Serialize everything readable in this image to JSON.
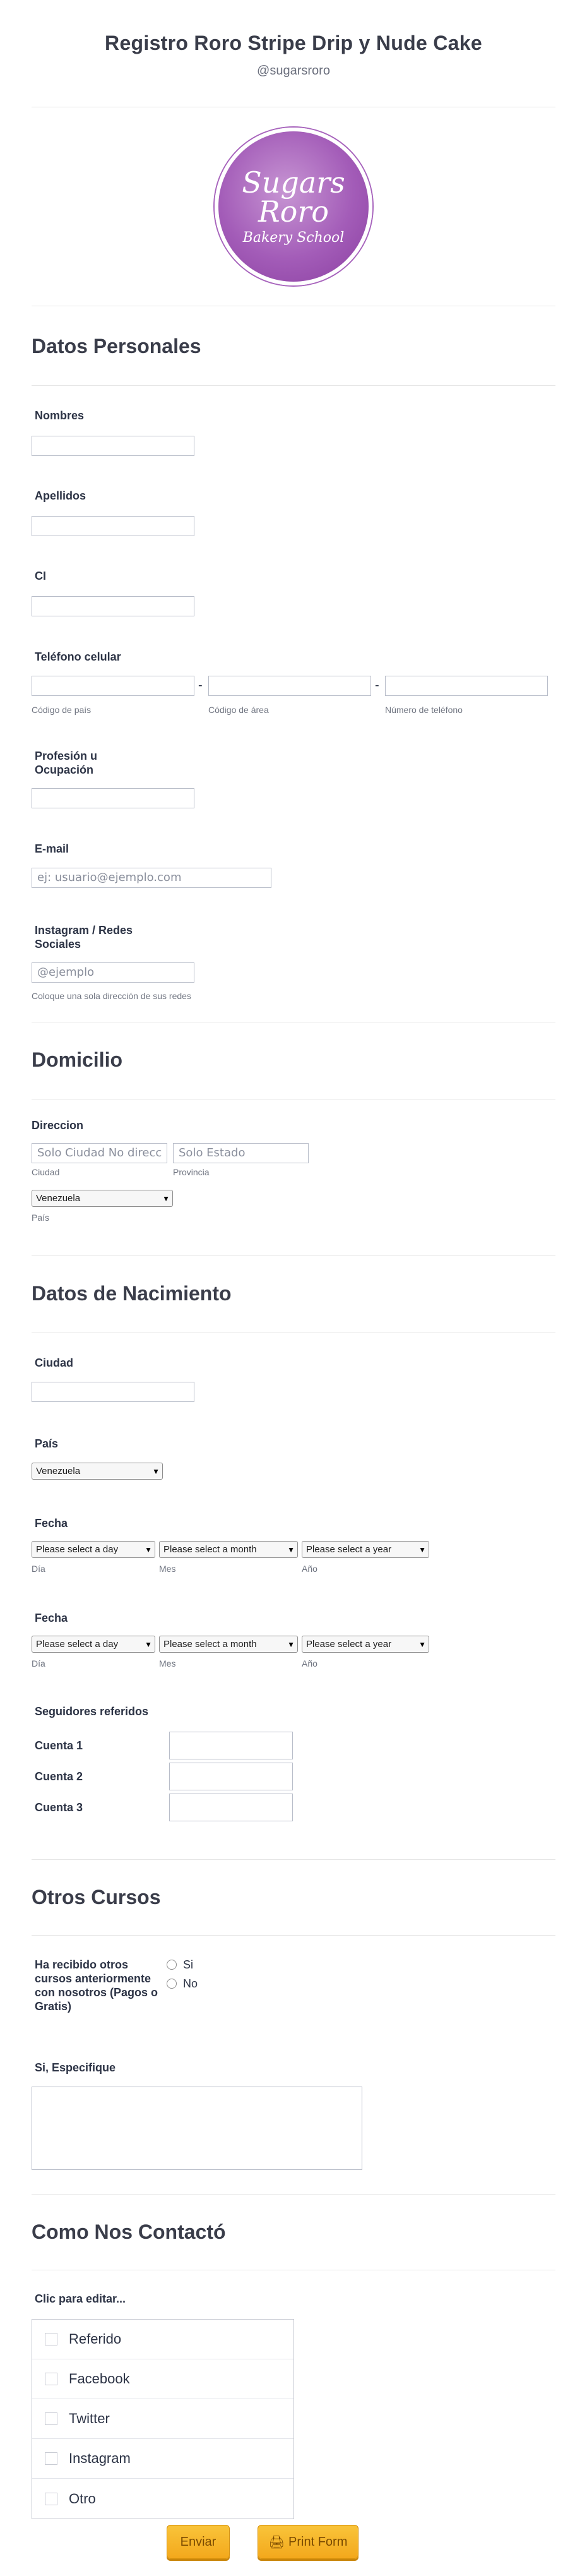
{
  "header": {
    "title": "Registro Roro Stripe Drip y Nude Cake",
    "subtitle": "@sugarsroro"
  },
  "logo": {
    "line1": "Sugars",
    "line2": "Roro",
    "line3": "Bakery School"
  },
  "sections": {
    "personal": "Datos Personales",
    "domicilio": "Domicilio",
    "nacimiento": "Datos de Nacimiento",
    "otros": "Otros Cursos",
    "contacto": "Como Nos Contactó"
  },
  "personal": {
    "nombres": "Nombres",
    "apellidos": "Apellidos",
    "ci": "CI",
    "telefono": "Teléfono celular",
    "tel_sub1": "Código de país",
    "tel_sub2": "Código de área",
    "tel_sub3": "Número de teléfono",
    "tel_sep": "-",
    "profesion": "Profesión u Ocupación",
    "email": "E-mail",
    "email_placeholder": "ej: usuario@ejemplo.com",
    "instagram": "Instagram / Redes Sociales",
    "instagram_placeholder": "@ejemplo",
    "instagram_sub": "Coloque una sola dirección de sus redes"
  },
  "domicilio": {
    "direccion": "Direccion",
    "ciudad_placeholder": "Solo Ciudad No direcc",
    "estado_placeholder": "Solo Estado",
    "ciudad_sub": "Ciudad",
    "provincia_sub": "Provincia",
    "pais_value": "Venezuela",
    "pais_sub": "País"
  },
  "nacimiento": {
    "ciudad": "Ciudad",
    "pais": "País",
    "pais_value": "Venezuela",
    "fecha1": "Fecha",
    "fecha2": "Fecha",
    "day_placeholder": "Please select a day",
    "month_placeholder": "Please select a month",
    "year_placeholder": "Please select a year",
    "dia_sub": "Día",
    "mes_sub": "Mes",
    "ano_sub": "Año",
    "seguidores": "Seguidores referidos",
    "cuentas": [
      "Cuenta 1",
      "Cuenta 2",
      "Cuenta 3"
    ]
  },
  "otros": {
    "question": "Ha recibido otros cursos anteriormente con nosotros (Pagos o Gratis)",
    "si": "Si",
    "no": "No",
    "especifique": "Si, Especifique"
  },
  "contacto": {
    "label": "Clic para editar...",
    "options": [
      "Referido",
      "Facebook",
      "Twitter",
      "Instagram",
      "Otro"
    ]
  },
  "buttons": {
    "submit": "Enviar",
    "print": "Print Form"
  },
  "colors": {
    "accent_button": "#f3a81c",
    "logo_purple": "#a35cb8"
  }
}
